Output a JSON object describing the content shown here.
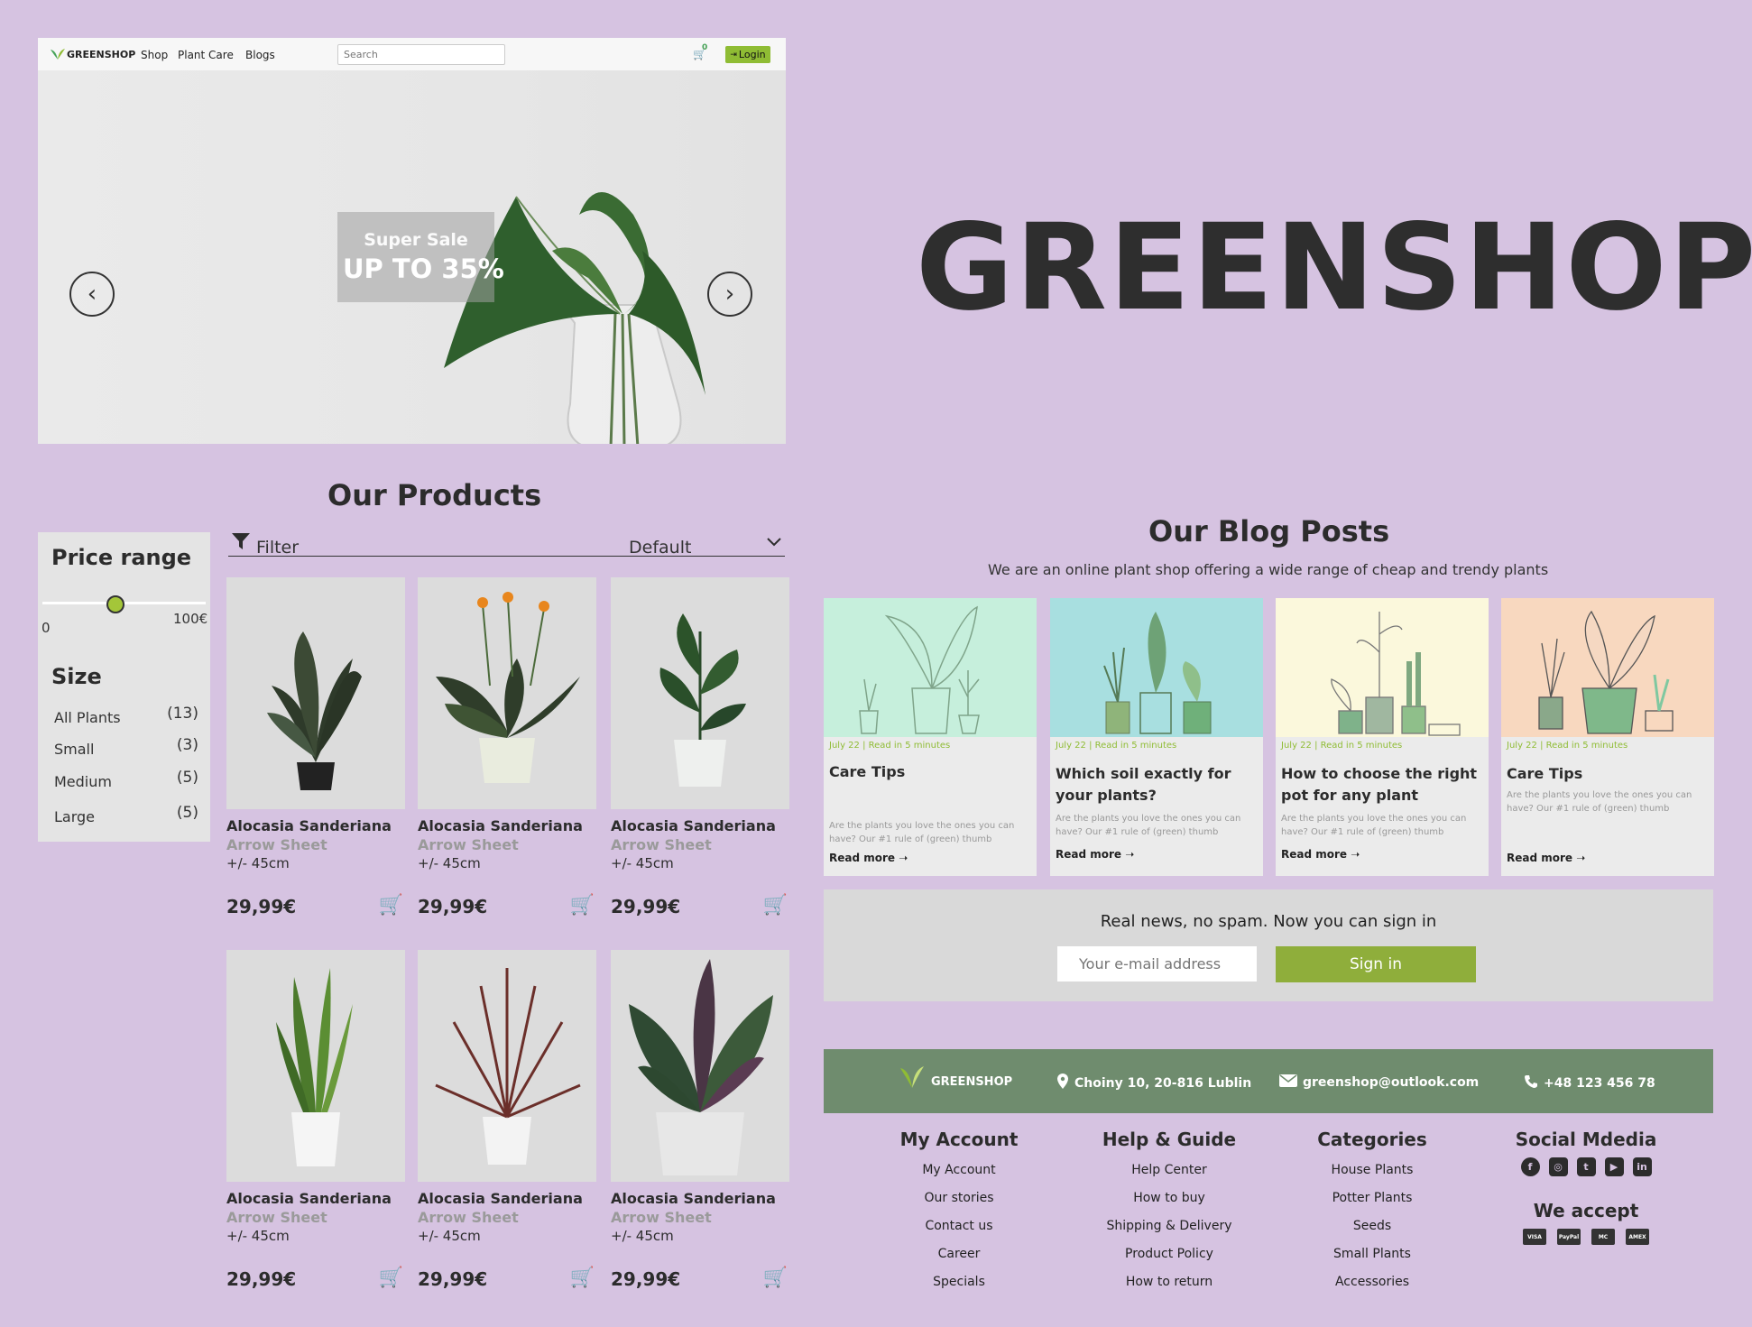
{
  "site": {
    "brand": "GREENSHOP",
    "nav": [
      "Shop",
      "Plant Care",
      "Blogs"
    ],
    "search_placeholder": "Search",
    "cart_count": "0",
    "login_label": "Login"
  },
  "hero": {
    "sale_line1": "Super Sale",
    "sale_line2": "UP TO 35%",
    "prev_icon": "chevron-left-icon",
    "next_icon": "chevron-right-icon"
  },
  "big_title": "GREENSHOP",
  "products": {
    "title": "Our Products",
    "price_range": {
      "heading": "Price range",
      "min": "0",
      "max": "100€",
      "value": 0.45
    },
    "size": {
      "heading": "Size",
      "items": [
        {
          "label": "All Plants",
          "count": "(13)"
        },
        {
          "label": "Small",
          "count": "(3)"
        },
        {
          "label": "Medium",
          "count": "(5)"
        },
        {
          "label": "Large",
          "count": "(5)"
        }
      ]
    },
    "filter_label": "Filter",
    "sort_label": "Default",
    "items": [
      {
        "name": "Alocasia Sanderiana",
        "sub": "Arrow Sheet",
        "size": "+/- 45cm",
        "price": "29,99€"
      },
      {
        "name": "Alocasia Sanderiana",
        "sub": "Arrow Sheet",
        "size": "+/- 45cm",
        "price": "29,99€"
      },
      {
        "name": "Alocasia Sanderiana",
        "sub": "Arrow Sheet",
        "size": "+/- 45cm",
        "price": "29,99€"
      },
      {
        "name": "Alocasia Sanderiana",
        "sub": "Arrow Sheet",
        "size": "+/- 45cm",
        "price": "29,99€"
      },
      {
        "name": "Alocasia Sanderiana",
        "sub": "Arrow Sheet",
        "size": "+/- 45cm",
        "price": "29,99€"
      },
      {
        "name": "Alocasia Sanderiana",
        "sub": "Arrow Sheet",
        "size": "+/- 45cm",
        "price": "29,99€"
      }
    ]
  },
  "blog": {
    "title": "Our Blog Posts",
    "subtitle": "We are an online plant shop offering a wide range of cheap and trendy plants",
    "posts": [
      {
        "meta": "July 22 | Read in 5 minutes",
        "title": "Care Tips",
        "desc": "Are the plants you love the ones you can have? Our #1 rule of (green) thumb",
        "more": "Read more",
        "bg": "#c6efdc"
      },
      {
        "meta": "July 22 | Read in 5 minutes",
        "title": "Which soil exactly for your plants?",
        "desc": "Are the plants you love the ones you can have? Our #1 rule of (green) thumb",
        "more": "Read more",
        "bg": "#a8dfe0"
      },
      {
        "meta": "July 22 | Read in 5 minutes",
        "title": "How to choose the right pot for any plant",
        "desc": "Are the plants you love the ones you can have? Our #1 rule of (green) thumb",
        "more": "Read more",
        "bg": "#fbf8dc"
      },
      {
        "meta": "July 22 | Read in 5 minutes",
        "title": "Care Tips",
        "desc": "Are the plants you love the ones you can have? Our #1 rule of (green) thumb",
        "more": "Read more",
        "bg": "#f8d8bf"
      }
    ]
  },
  "newsletter": {
    "title": "Real news, no spam. Now you can sign in",
    "placeholder": "Your e-mail address",
    "button": "Sign in"
  },
  "footer": {
    "brand": "GREENSHOP",
    "address": "Choiny 10, 20-816 Lublin",
    "email": "greenshop@outlook.com",
    "phone": "+48 123 456 78",
    "columns": [
      {
        "heading": "My Account",
        "links": [
          "My Account",
          "Our stories",
          "Contact us",
          "Career",
          "Specials"
        ]
      },
      {
        "heading": "Help & Guide",
        "links": [
          "Help Center",
          "How to buy",
          "Shipping & Delivery",
          "Product Policy",
          "How to return"
        ]
      },
      {
        "heading": "Categories",
        "links": [
          "House Plants",
          "Potter Plants",
          "Seeds",
          "Small Plants",
          "Accessories"
        ]
      }
    ],
    "social_heading": "Social Mdedia",
    "social_icons": [
      "facebook-icon",
      "instagram-icon",
      "twitter-icon",
      "youtube-icon",
      "linkedin-icon"
    ],
    "accept_heading": "We accept",
    "payments": [
      "VISA",
      "PayPal",
      "MC",
      "AMEX"
    ]
  },
  "colors": {
    "background": "#d6c3e1",
    "accent_green": "#8fbc34",
    "footer_bar": "#6f8c6e",
    "signin_button": "#8fae3b"
  }
}
